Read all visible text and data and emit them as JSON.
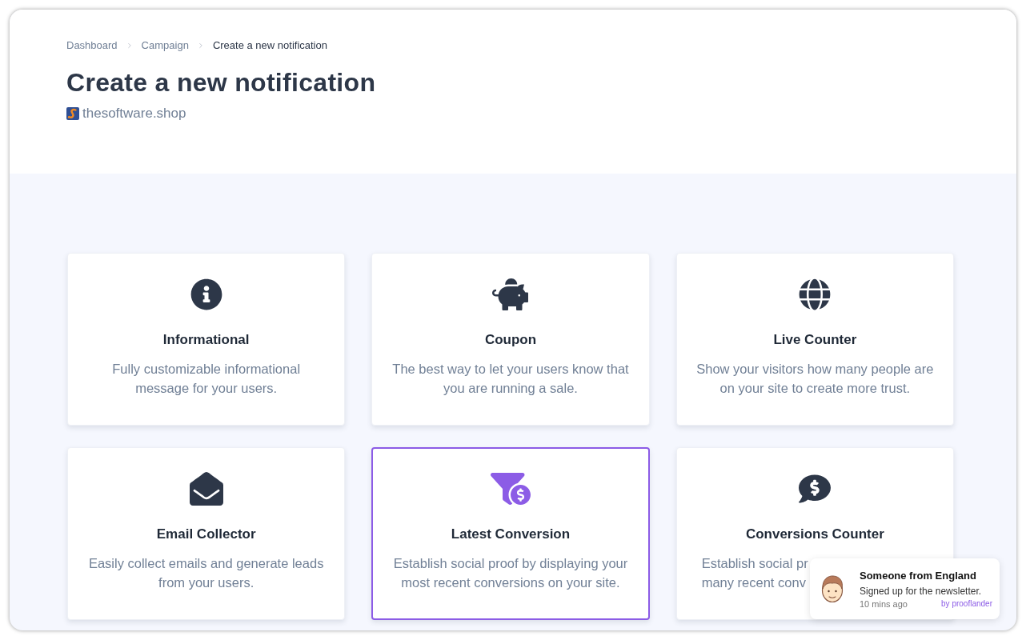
{
  "breadcrumb": [
    {
      "label": "Dashboard",
      "current": false
    },
    {
      "label": "Campaign",
      "current": false
    },
    {
      "label": "Create a new notification",
      "current": true
    }
  ],
  "title": "Create a new notification",
  "site": {
    "name": "thesoftware.shop"
  },
  "cards": [
    {
      "kind": "info",
      "title": "Informational",
      "description": [
        "Fully customizable informational",
        "message for your users."
      ],
      "selected": false,
      "covered": false
    },
    {
      "kind": "coupon",
      "title": "Coupon",
      "description": [
        "The best way to let your users know that",
        "you are running a sale."
      ],
      "selected": false,
      "covered": false
    },
    {
      "kind": "live",
      "title": "Live Counter",
      "description": [
        "Show your visitors how many people are",
        "on your site to create more trust."
      ],
      "selected": false,
      "covered": false
    },
    {
      "kind": "email",
      "title": "Email Collector",
      "description": [
        "Easily collect emails and generate leads",
        "from your users."
      ],
      "selected": false,
      "covered": false
    },
    {
      "kind": "conversion",
      "title": "Latest Conversion",
      "description": [
        "Establish social proof by displaying your",
        "most recent conversions on your site."
      ],
      "selected": true,
      "covered": false
    },
    {
      "kind": "counter",
      "title": "Conversions Counter",
      "description": [
        "Establish social pr",
        "many recent conv"
      ],
      "selected": false,
      "covered": true
    }
  ],
  "popup": {
    "title": "Someone from England",
    "message": "Signed up for the newsletter.",
    "time": "10 mins ago",
    "credit": "by prooflander"
  }
}
